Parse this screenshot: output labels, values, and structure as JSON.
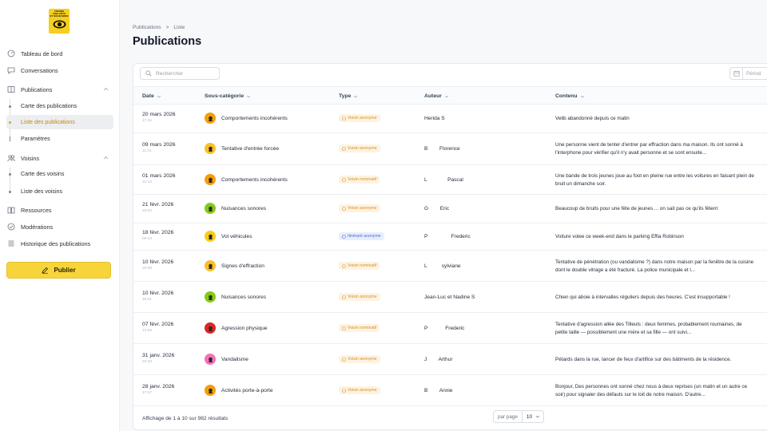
{
  "app": {
    "logo_text": [
      "VOISINS",
      "VIGILANTS",
      "ET SOLIDAIRES"
    ]
  },
  "sidebar": {
    "items": [
      {
        "label": "Tableau de bord",
        "icon": "dashboard-icon"
      },
      {
        "label": "Conversations",
        "icon": "chat-icon"
      },
      {
        "label": "Publications",
        "icon": "publications-icon",
        "expanded": true
      },
      {
        "label": "Carte des publications"
      },
      {
        "label": "Liste des publications",
        "active": true
      },
      {
        "label": "Paramètres",
        "icon": "settings-icon"
      },
      {
        "label": "Voisins",
        "icon": "users-icon",
        "expanded": true
      },
      {
        "label": "Carte des voisins"
      },
      {
        "label": "Liste des voisins"
      },
      {
        "label": "Ressources",
        "icon": "book-icon"
      },
      {
        "label": "Modérations",
        "icon": "check-circle-icon"
      },
      {
        "label": "Historique des publications",
        "icon": "history-icon"
      }
    ],
    "publish_label": "Publier"
  },
  "breadcrumb": {
    "parent": "Publications",
    "separator": ">",
    "current": "Liste"
  },
  "page_title": "Publications",
  "search": {
    "placeholder": "Rechercher"
  },
  "date_filter": {
    "placeholder": "Périod"
  },
  "table": {
    "headers": {
      "date": "Date",
      "subcategory": "Sous-catégorie",
      "type": "Type",
      "author": "Auteur",
      "content": "Contenu"
    },
    "rows": [
      {
        "date": "20 mars 2026",
        "time": "17:34",
        "subcategory": "Comportements incohérents",
        "type": "Voisin anonyme",
        "type_kind": "anon",
        "author": "Herida S",
        "content": "Velib abandonné depuis ce matin",
        "avatar_color": "#f59e0b"
      },
      {
        "date": "09 mars 2026",
        "time": "11:31",
        "subcategory": "Tentative d'entrée forcée",
        "type": "Voisin anonyme",
        "type_kind": "anon",
        "author": "B        Florence",
        "content": "Une personne vient de tenter d'entrer par effraction dans ma maison. Ils ont sonné à l'interphone pour vérifier qu'il n'y avait personne et se sont ensuite...",
        "avatar_color": "#fbbf24"
      },
      {
        "date": "01 mars 2026",
        "time": "21:12",
        "subcategory": "Comportements incohérents",
        "type": "Voisin nominatif",
        "type_kind": "nom",
        "author": "L              Pascal",
        "content": "Une bande de trois jeunes joue au foot en pleine rue entre les voitures en faisant plein de bruit un dimanche soir.",
        "avatar_color": "#f59e0b"
      },
      {
        "date": "21 févr. 2026",
        "time": "22:04",
        "subcategory": "Nuisances sonores",
        "type": "Voisin anonyme",
        "type_kind": "anon",
        "author": "G        Eric",
        "content": "Beaucoup de bruits pour une fête de jeunes ... on sait pas ce qu'ils fêtent",
        "avatar_color": "#84cc16"
      },
      {
        "date": "18 févr. 2026",
        "time": "08:13",
        "subcategory": "Vol véhicules",
        "type": "Itinérant anonyme",
        "type_kind": "itin",
        "author": "P                Frederic",
        "content": "Voiture volee ce week-end dans le parking Effia Robinson",
        "avatar_color": "#facc15"
      },
      {
        "date": "10 févr. 2026",
        "time": "20:09",
        "subcategory": "Signes d'effraction",
        "type": "Voisin nominatif",
        "type_kind": "nom",
        "author": "L          sylviane",
        "content": "Tentative de pénétration (ou vandalisme ?) dans notre maison par la fenêtre de la cuisine dont le double vitrage a été fracturé. La police municipale et l...",
        "avatar_color": "#fbbf24"
      },
      {
        "date": "10 févr. 2026",
        "time": "18:01",
        "subcategory": "Nuisances sonores",
        "type": "Voisin anonyme",
        "type_kind": "anon",
        "author": "Jean-Luc et Nadine S",
        "content": "Chien qui aboie à intervalles réguliers depuis des heures. C'est insupportable !",
        "avatar_color": "#84cc16"
      },
      {
        "date": "07 févr. 2026",
        "time": "12:09",
        "subcategory": "Agression physique",
        "type": "Voisin nominatif",
        "type_kind": "nom",
        "author": "P            Frederic",
        "content": "Tentative d'agression allée des Tilleuls : deux femmes, probablement roumaines, de petite taille — possiblement une mère et sa fille — ont suivi...",
        "avatar_color": "#dc2626"
      },
      {
        "date": "31 janv. 2026",
        "time": "23:16",
        "subcategory": "Vandalisme",
        "type": "Voisin anonyme",
        "type_kind": "anon",
        "author": "J        Arthur",
        "content": "Pétards dans la rue, lancer de feux d'artifice sur des bâtiments de la résidence.",
        "avatar_color": "#f472b6"
      },
      {
        "date": "28 janv. 2026",
        "time": "17:57",
        "subcategory": "Activités porte-à-porte",
        "type": "Voisin anonyme",
        "type_kind": "anon",
        "author": "B        Annie",
        "content": "Bonjour, Des personnes ont sonné chez nous à deux reprises (un matin et un autre ce soir) pour signaler des défauts sur le toit de notre maison. D'autre...",
        "avatar_color": "#f59e0b"
      }
    ]
  },
  "footer": {
    "results_text": "Affichage de 1 à 10 sur 982 résultats",
    "per_page_label": "par page",
    "per_page_value": "10"
  },
  "colors": {
    "accent": "#f7d53a",
    "active_text": "#c08a06"
  }
}
